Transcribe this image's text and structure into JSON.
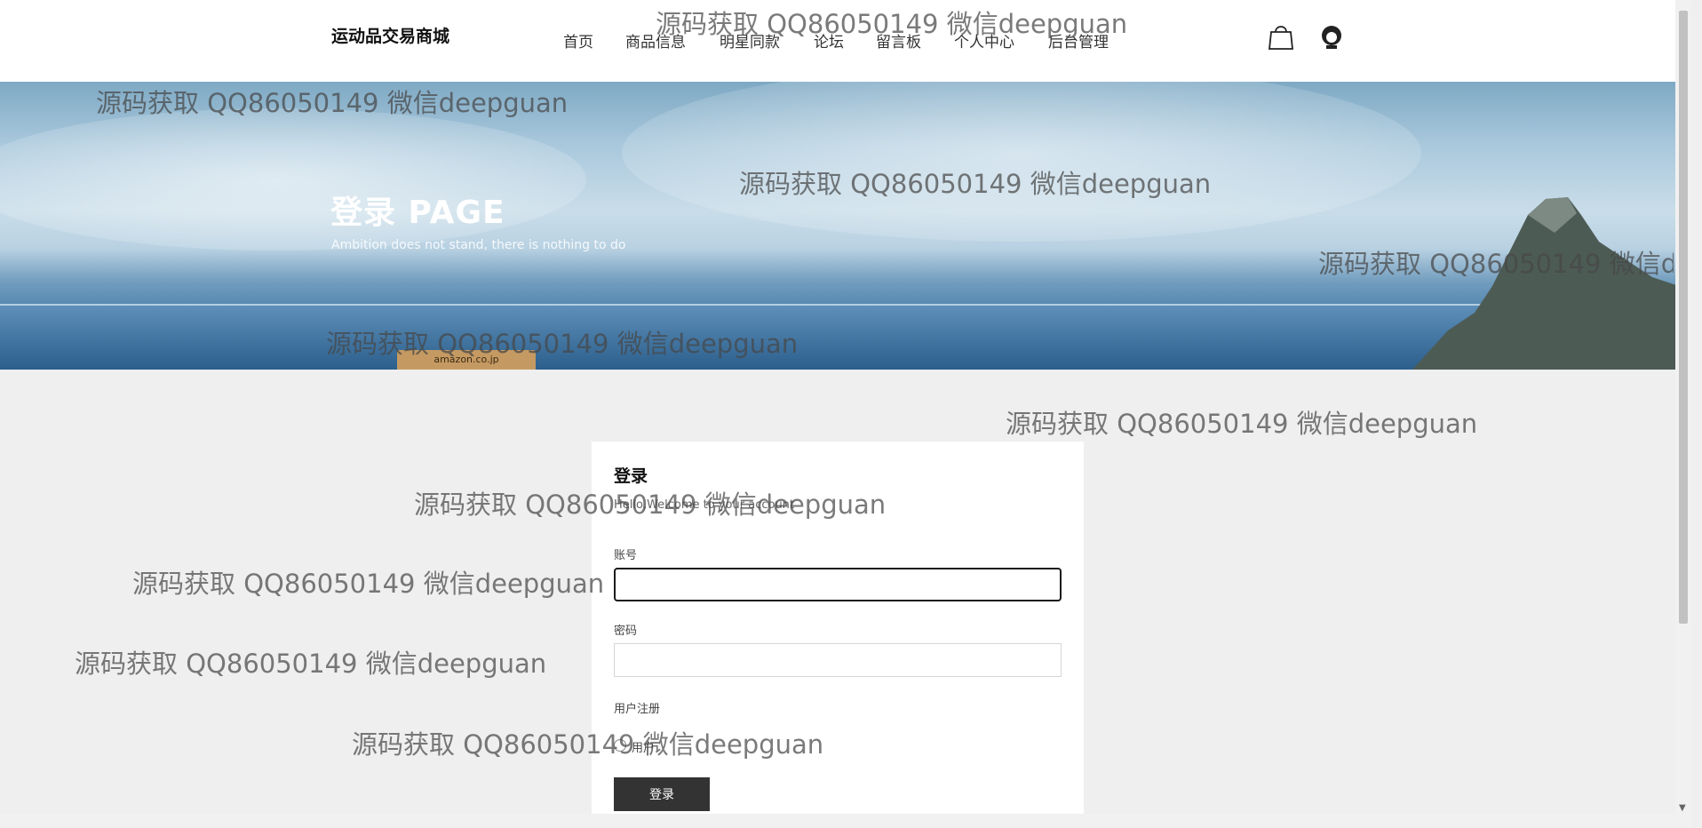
{
  "header": {
    "brand": "运动品交易商城",
    "nav": [
      "首页",
      "商品信息",
      "明星同款",
      "论坛",
      "留言板",
      "个人中心",
      "后台管理"
    ],
    "icons": [
      "shopping-bag-icon",
      "user-avatar-icon"
    ]
  },
  "banner": {
    "title": "登录 PAGE",
    "subtitle": "Ambition does not stand, there is nothing to do",
    "box_label": "amazon.co.jp"
  },
  "login": {
    "title": "登录",
    "subtitle": "Hello,Welcome to your account",
    "account_label": "账号",
    "account_value": "",
    "password_label": "密码",
    "password_value": "",
    "register_label": "用户注册",
    "role_option": "用户",
    "submit_label": "登录"
  },
  "watermark": "源码获取 QQ86050149 微信deepguan"
}
